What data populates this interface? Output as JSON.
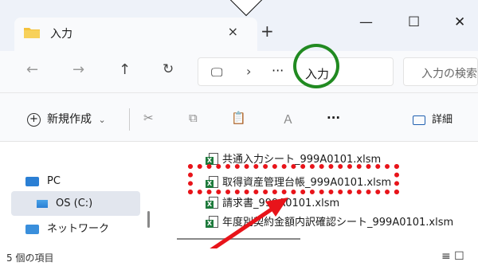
{
  "tab": {
    "title": "入力",
    "close": "×"
  },
  "newtab": "+",
  "window": {
    "minimize": "—",
    "maximize": "☐",
    "close": "✕"
  },
  "nav": {
    "back": "←",
    "forward": "→",
    "up": "↑",
    "refresh": "↻"
  },
  "address": {
    "pc_icon": "🖵",
    "sep": "›",
    "more": "···",
    "crumb": "入力"
  },
  "search": {
    "placeholder": "入力の検索"
  },
  "toolbar": {
    "new_label": "新規作成",
    "new_chevron": "⌄",
    "cut": "✂",
    "copy": "⧉",
    "paste": "📋",
    "rename": "Ａ",
    "more": "···",
    "details_label": "詳細"
  },
  "sidebar": {
    "items": [
      {
        "label": "PC"
      },
      {
        "label": "OS (C:)"
      },
      {
        "label": "ネットワーク"
      }
    ]
  },
  "files": [
    {
      "name": "共通入力シート_999A0101.xlsm"
    },
    {
      "name": "取得資産管理台帳_999A0101.xlsm"
    },
    {
      "name": "請求書_999A0101.xlsm"
    },
    {
      "name": "年度別契約金額内訳確認シート_999A0101.xlsm"
    }
  ],
  "status": {
    "count": "5 個の項目"
  },
  "colors": {
    "highlight_circle": "#218a21",
    "highlight_box": "#e8141a",
    "excel_green": "#1e7a3c",
    "accent_blue": "#2060b0"
  },
  "icons": {
    "folder": "folder-icon",
    "excel": "excel-file-icon",
    "pc": "pc-icon",
    "drive": "drive-icon",
    "network": "network-icon"
  }
}
